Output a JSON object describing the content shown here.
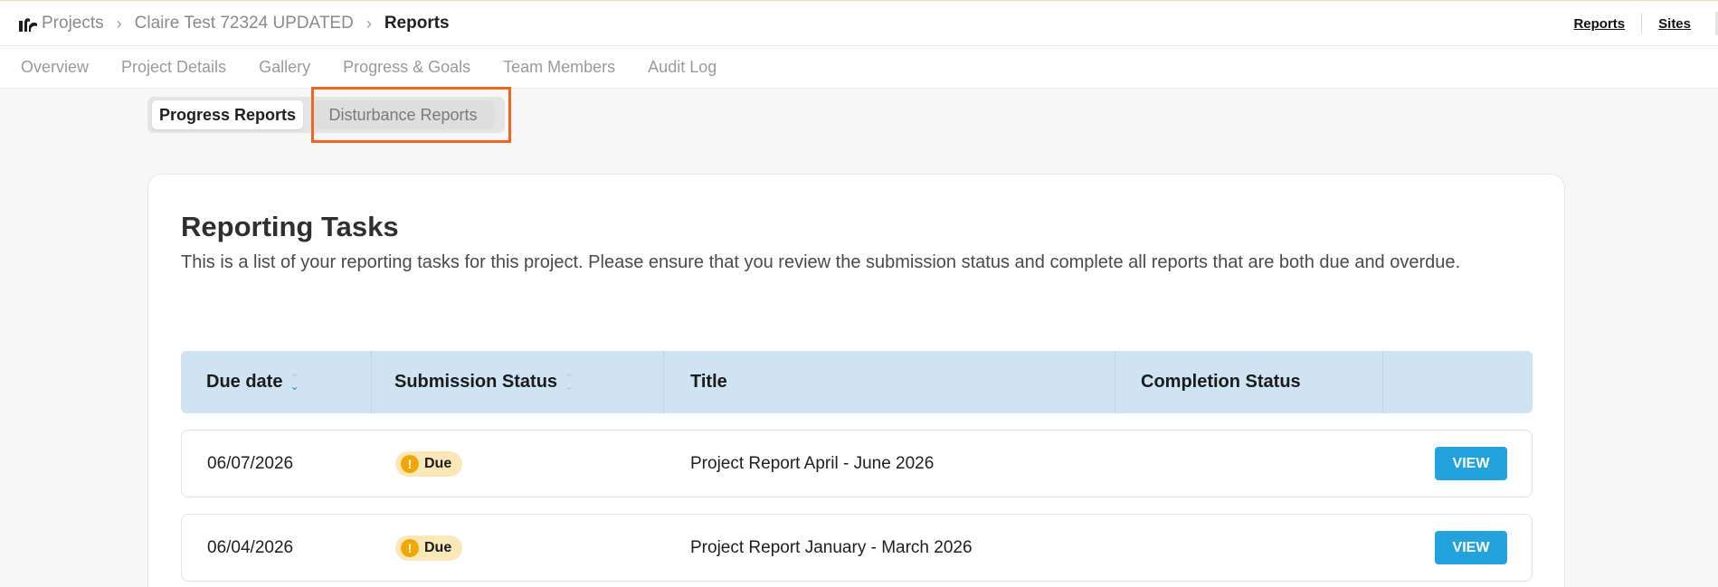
{
  "breadcrumb": {
    "items": [
      "Projects",
      "Claire Test 72324 UPDATED",
      "Reports"
    ]
  },
  "top_links": {
    "reports": "Reports",
    "sites": "Sites"
  },
  "subnav": {
    "tabs": [
      "Overview",
      "Project Details",
      "Gallery",
      "Progress & Goals",
      "Team Members",
      "Audit Log"
    ]
  },
  "report_toggle": {
    "progress": "Progress Reports",
    "disturbance": "Disturbance Reports",
    "selected": "Progress Reports"
  },
  "card": {
    "title": "Reporting Tasks",
    "description": "This is a list of your reporting tasks for this project. Please ensure that you review the submission status and complete all reports that are both due and overdue."
  },
  "table": {
    "columns": [
      "Due date",
      "Submission Status",
      "Title",
      "Completion Status",
      ""
    ],
    "rows": [
      {
        "due_date": "06/07/2026",
        "status": "Due",
        "title": "Project Report April - June 2026",
        "completion": "",
        "action": "VIEW"
      },
      {
        "due_date": "06/04/2026",
        "status": "Due",
        "title": "Project Report January - March 2026",
        "completion": "",
        "action": "VIEW"
      }
    ]
  },
  "colors": {
    "accent": "#23a3de",
    "table_header": "#cfe4f2",
    "badge_bg": "#fbe7b8",
    "warning": "#f2a600",
    "highlight": "#f0651f"
  }
}
